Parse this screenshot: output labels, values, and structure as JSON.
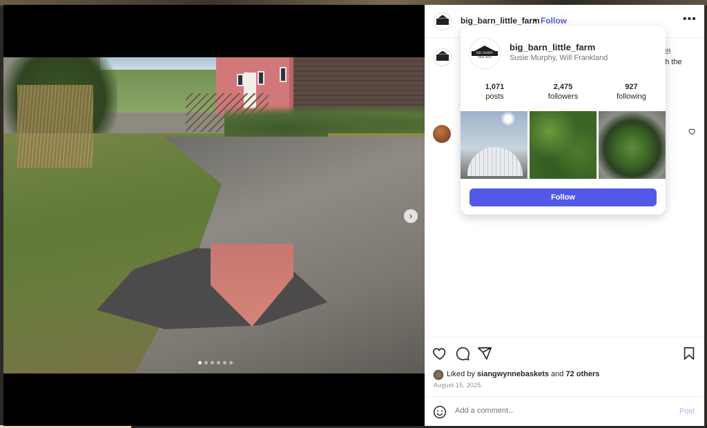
{
  "post": {
    "username": "big_barn_little_farm",
    "separator": "•",
    "follow_label": "Follow",
    "more_icon": "more-horizontal-icon",
    "caption_tail_line1": "st!!",
    "caption_tail_line2": "gh the",
    "carousel": {
      "slide_count": 6,
      "active_index": 0,
      "next_icon": "chevron-right-icon"
    },
    "likes": {
      "prefix": "Liked by",
      "user": "siangwynnebaskets",
      "joiner": "and",
      "others": "72 others"
    },
    "date": "August 15, 2025",
    "comment_placeholder": "Add a comment...",
    "post_label": "Post"
  },
  "hovercard": {
    "username": "big_barn_little_farm",
    "followed_by": "Susie Murphy, Will Frankland",
    "logo_text": "BIG BARN",
    "logo_subtext": "little farm",
    "stats": [
      {
        "value": "1,071",
        "label": "posts"
      },
      {
        "value": "2,475",
        "label": "followers"
      },
      {
        "value": "927",
        "label": "following"
      }
    ],
    "follow_label": "Follow"
  },
  "colors": {
    "accent": "#5259e8",
    "link": "#4f5bd5",
    "muted": "#737373"
  }
}
